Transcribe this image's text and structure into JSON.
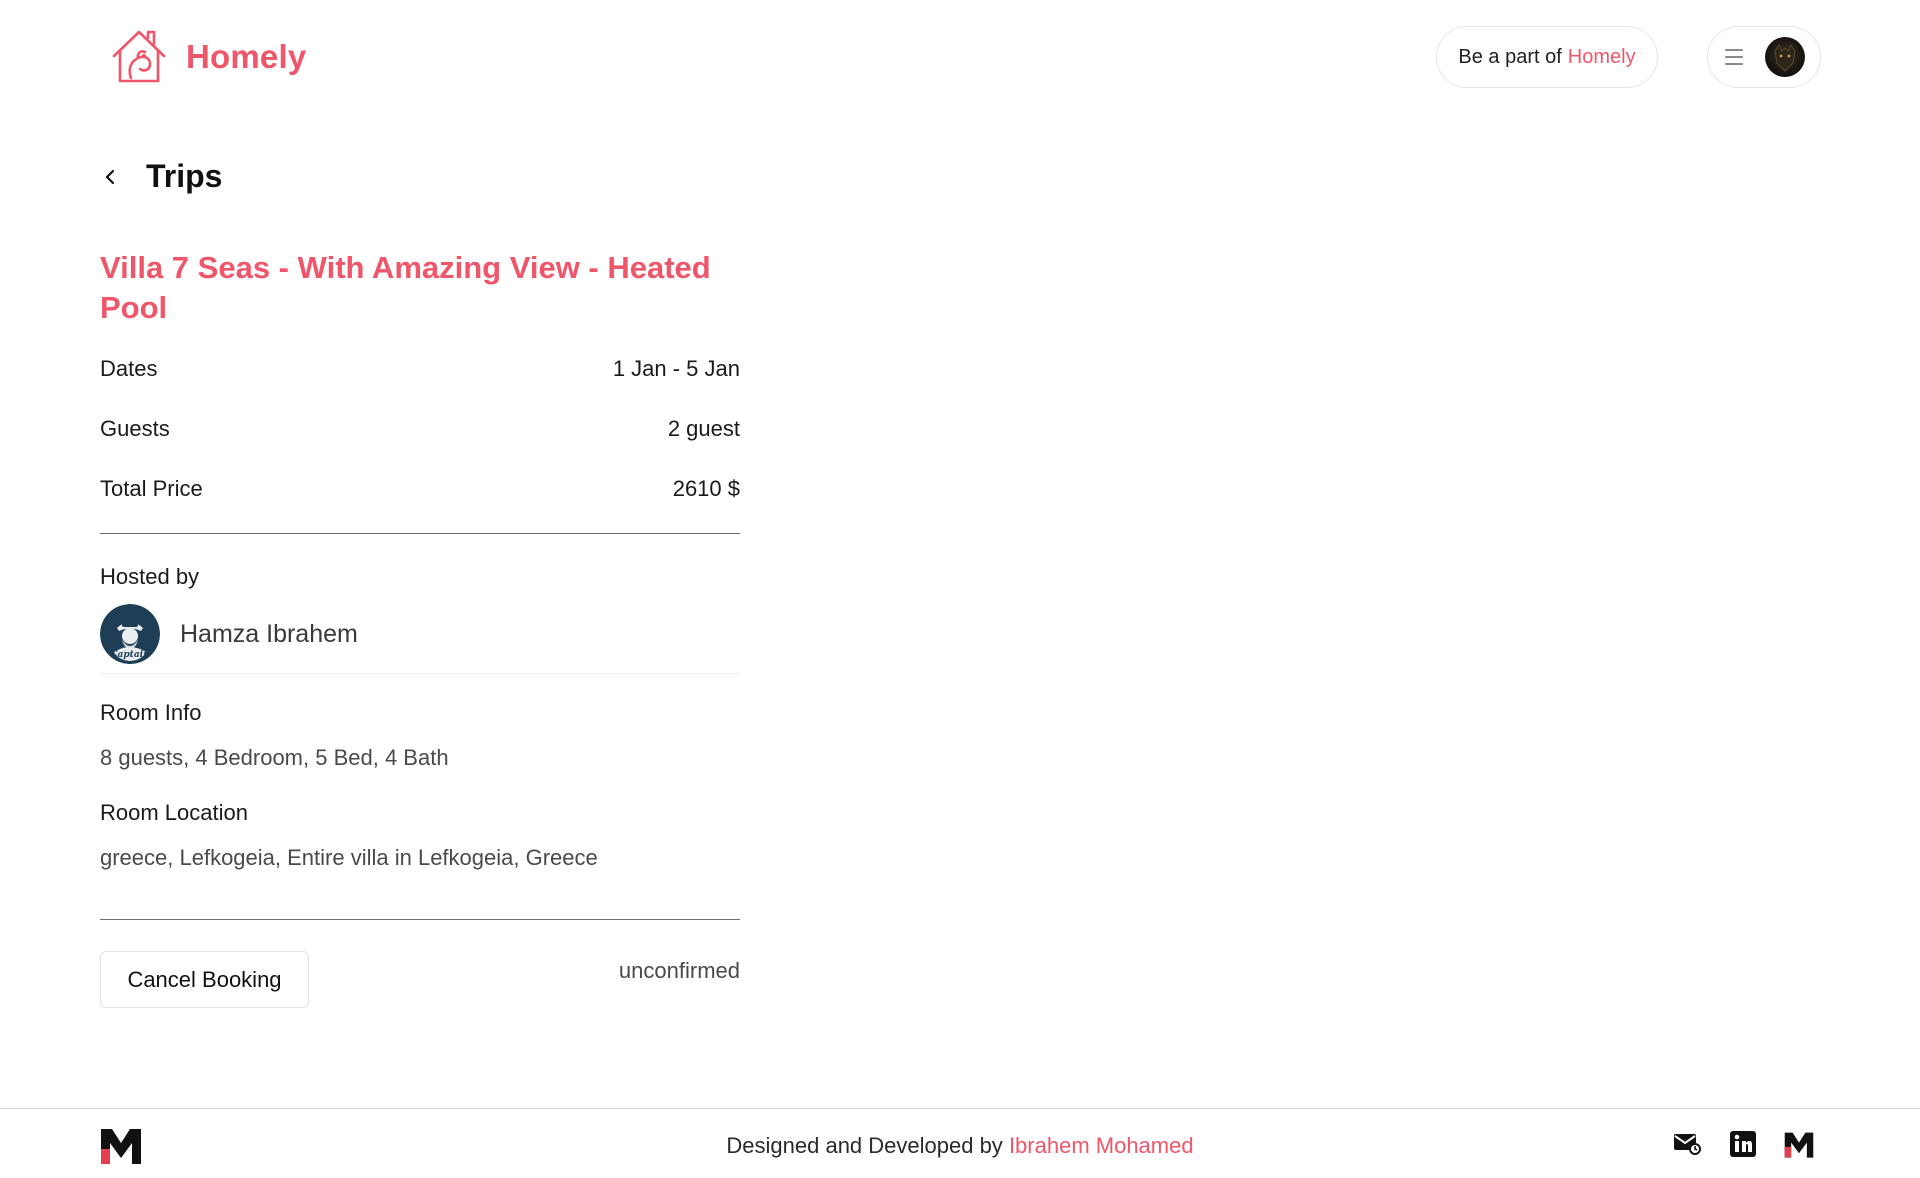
{
  "header": {
    "brand_name": "Homely",
    "host_cta_prefix": "Be a part of",
    "host_cta_brand": "Homely"
  },
  "page": {
    "title": "Trips"
  },
  "booking": {
    "listing_title": "Villa 7 Seas - With Amazing View - Heated Pool",
    "details": [
      {
        "label": "Dates",
        "value": "1 Jan - 5 Jan"
      },
      {
        "label": "Guests",
        "value": "2 guest"
      },
      {
        "label": "Total Price",
        "value": "2610 $"
      }
    ],
    "hosted_by_label": "Hosted by",
    "host_name": "Hamza Ibrahem",
    "room_info_label": "Room Info",
    "room_info": "8 guests, 4 Bedroom, 5 Bed, 4 Bath",
    "room_location_label": "Room Location",
    "room_location": "greece, Lefkogeia, Entire villa in Lefkogeia, Greece",
    "cancel_label": "Cancel Booking",
    "status": "unconfirmed"
  },
  "footer": {
    "credit_prefix": "Designed and Developed by",
    "credit_name": "Ibrahem Mohamed",
    "icons": [
      "mail-icon",
      "linkedin-icon",
      "portfolio-logo-icon"
    ]
  },
  "colors": {
    "accent": "#f0566a",
    "text": "#1a1a1a",
    "muted": "#4a4a4a",
    "border": "#e6e6e6"
  }
}
